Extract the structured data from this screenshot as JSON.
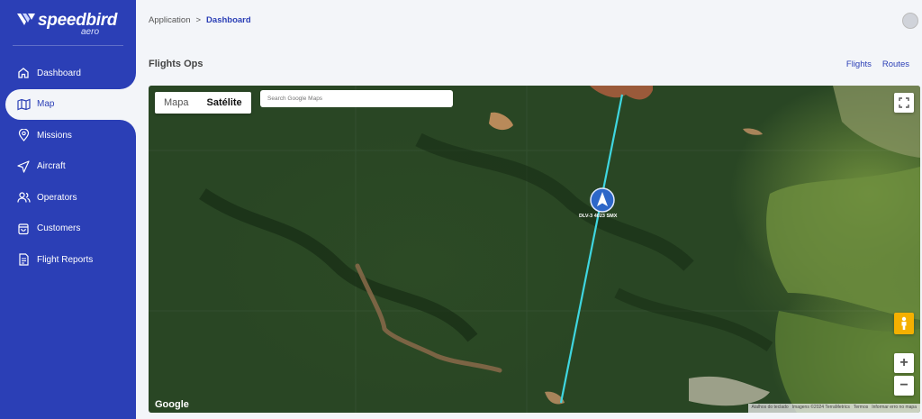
{
  "brand": {
    "name": "speedbird",
    "suffix": "aero"
  },
  "sidebar": {
    "items": [
      {
        "label": "Dashboard",
        "icon": "home-icon"
      },
      {
        "label": "Map",
        "icon": "map-icon",
        "active": true
      },
      {
        "label": "Missions",
        "icon": "location-pin-icon"
      },
      {
        "label": "Aircraft",
        "icon": "navigation-arrow-icon"
      },
      {
        "label": "Operators",
        "icon": "users-icon"
      },
      {
        "label": "Customers",
        "icon": "bag-icon"
      },
      {
        "label": "Flight Reports",
        "icon": "document-icon"
      }
    ]
  },
  "breadcrumb": {
    "root": "Application",
    "separator": ">",
    "current": "Dashboard"
  },
  "page": {
    "title": "Flights Ops"
  },
  "top_links": {
    "flights": "Flights",
    "routes": "Routes"
  },
  "map": {
    "type_control": {
      "map": "Mapa",
      "satellite": "Satélite",
      "selected": "Satélite"
    },
    "search": {
      "placeholder": "Search Google Maps"
    },
    "aircraft_label": "DLV-3 4023 SMX",
    "google_logo": "Google",
    "attribution": [
      "Atalhos do teclado",
      "Imagens ©2024 TerraMetrics",
      "Termos",
      "Informar erro no mapa"
    ],
    "zoom_in": "+",
    "zoom_out": "−",
    "colors": {
      "route_line": "#3fd6e0",
      "marker": "#2d67c8"
    }
  },
  "colors": {
    "sidebar": "#2b3fb6",
    "accent": "#2b3fb6",
    "background": "#f3f5f9"
  }
}
